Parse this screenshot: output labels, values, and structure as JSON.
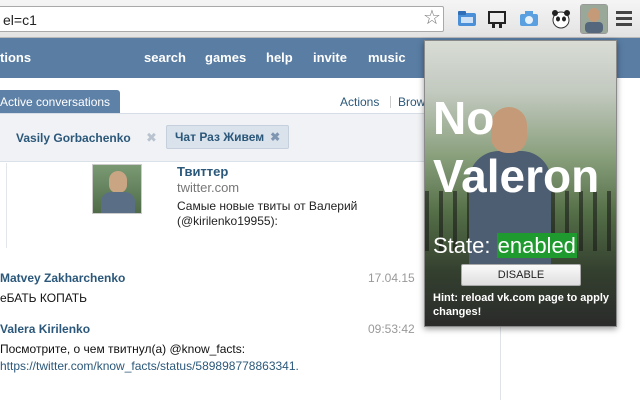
{
  "browser": {
    "url": "el=c1",
    "extensions": [
      "folder-ext-icon",
      "cast-ext-icon",
      "camera-ext-icon",
      "panda-ext-icon",
      "no-valeron-ext-icon"
    ]
  },
  "header": {
    "nav": [
      {
        "label": "tions"
      },
      {
        "label": "search"
      },
      {
        "label": "games"
      },
      {
        "label": "help"
      },
      {
        "label": "invite"
      },
      {
        "label": "music"
      }
    ]
  },
  "tabs": {
    "active": "Active conversations",
    "actions": "Actions",
    "browse": "Brow"
  },
  "peers": [
    {
      "name": "Vasily Gorbachenko",
      "close": "✖"
    },
    {
      "name": "Чат Раз Живем",
      "close": "✖"
    }
  ],
  "link_preview": {
    "title": "Твиттер",
    "domain": "twitter.com",
    "description": "Самые новые твиты от Валерий (@kirilenko19955):"
  },
  "messages": [
    {
      "author": "Matvey Zakharchenko",
      "time": "17.04.15",
      "text": "еБАТЬ КОПАТЬ"
    },
    {
      "author": "Valera Kirilenko",
      "time": "09:53:42",
      "text": "Посмотрите, о чем твитнул(а) @know_facts:",
      "link": "https://twitter.com/know_facts/status/589898778863341."
    }
  ],
  "popup": {
    "title_line1": "No",
    "title_line2": "Valeron",
    "state_label": "State:",
    "state_value": "enabled",
    "button_label": "DISABLE",
    "hint": "Hint: reload vk.com page to apply changes!"
  },
  "colors": {
    "vk_header": "#597da3",
    "state_enabled": "#1f9a2e"
  }
}
